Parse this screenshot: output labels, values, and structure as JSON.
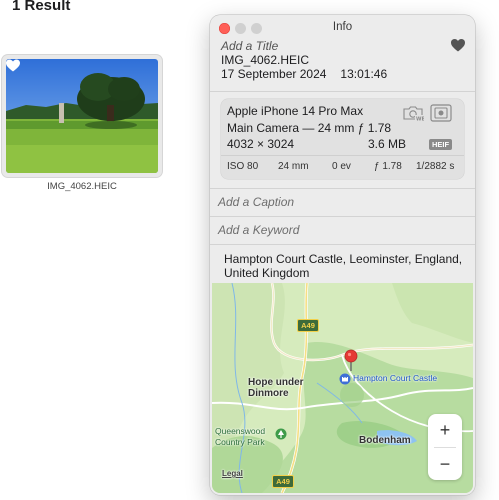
{
  "results": {
    "title": "1 Result"
  },
  "thumbnail": {
    "filename": "IMG_4062.HEIC"
  },
  "info": {
    "window_title": "Info",
    "add_title_placeholder": "Add a Title",
    "filename": "IMG_4062.HEIC",
    "date": "17 September 2024",
    "time": "13:01:46",
    "camera": {
      "model": "Apple iPhone 14 Pro Max",
      "lens": "Main Camera — 24 mm ƒ 1.78",
      "dimensions": "4032 × 3024",
      "file_size": "3.6 MB",
      "format_badge": "HEIF",
      "iso": "ISO 80",
      "focal_length": "24 mm",
      "exposure_bias": "0 ev",
      "aperture": "ƒ 1.78",
      "shutter": "1/2882 s"
    },
    "caption_placeholder": "Add a Caption",
    "keyword_placeholder": "Add a Keyword",
    "location": "Hampton Court Castle, Leominster, England, United Kingdom",
    "map": {
      "labels": {
        "road_top": "A49",
        "road_bottom": "A49",
        "hope_under_dinmore": "Hope under Dinmore",
        "hampton_court_castle": "Hampton Court Castle",
        "queenswood": "Queenswood Country Park",
        "bodenham": "Bodenham",
        "legal": "Legal"
      },
      "zoom_in": "+",
      "zoom_out": "−"
    }
  },
  "colors": {
    "close_button": "#ff5f57",
    "map_green": "#cfe6b4",
    "map_forest": "#a9d38f",
    "water": "#8ec3f0",
    "pin": "#e53935"
  }
}
